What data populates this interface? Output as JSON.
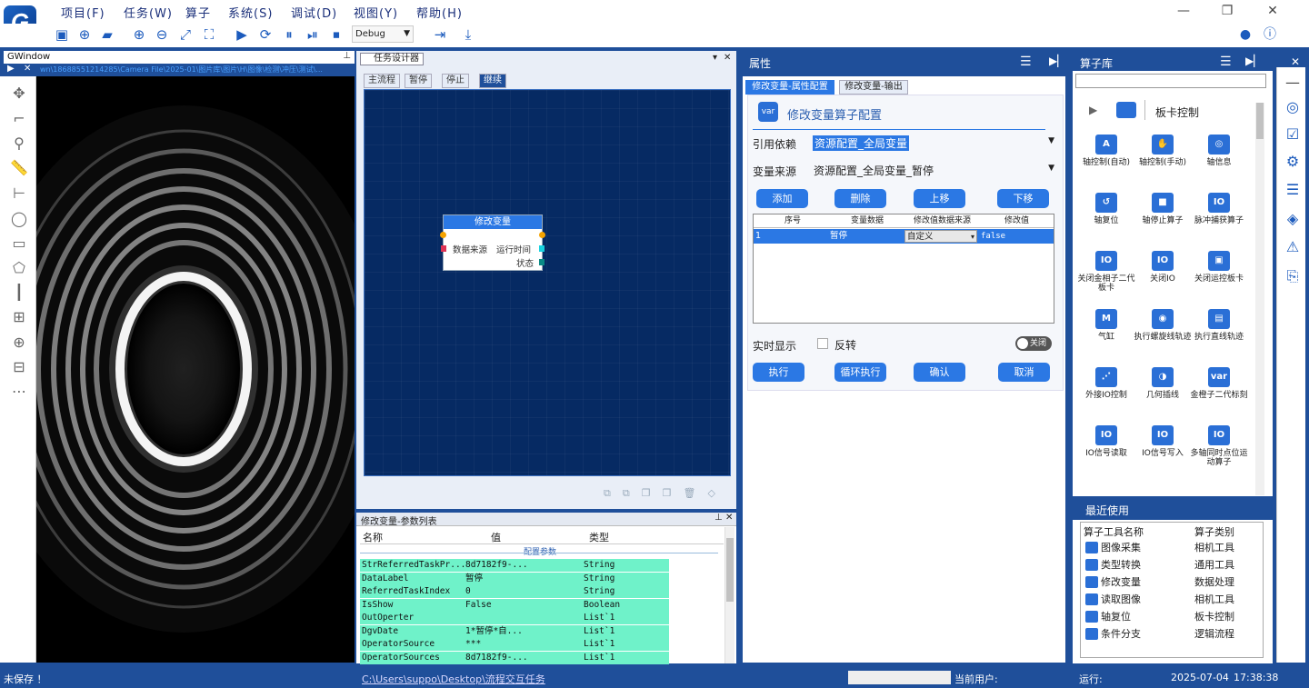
{
  "menu": [
    "项目(F)",
    "任务(W)",
    "算子",
    "系统(S)",
    "调试(D)",
    "视图(Y)",
    "帮助(H)"
  ],
  "toolbar": {
    "mode": "Debug"
  },
  "image_window": {
    "title": "GWindow",
    "path_overlay": "wn\\18688551214285\\Camera File\\2025-01\\图片库\\图片\\H\\图像\\检测\\冲压\\测试\\..."
  },
  "designer": {
    "title": "任务设计器",
    "tabs": [
      "主流程",
      "暂停",
      "停止",
      "继续"
    ],
    "node": {
      "title": "修改变量",
      "input": "数据来源",
      "output": "运行时间",
      "status": "状态"
    }
  },
  "params": {
    "title": "修改变量-参数列表",
    "headers": [
      "名称",
      "值",
      "类型"
    ],
    "group": "配置参数",
    "rows": [
      [
        "StrReferredTaskPr...",
        "8d7182f9-...",
        "String"
      ],
      [
        "DataLabel",
        "暂停",
        "String"
      ],
      [
        "ReferredTaskIndex",
        "0",
        "String"
      ],
      [
        "IsShow",
        "False",
        "Boolean"
      ],
      [
        "OutOperter",
        "",
        "List`1"
      ],
      [
        "DgvDate",
        "1*暂停*自...",
        "List`1"
      ],
      [
        "OperatorSource",
        "***",
        "List`1"
      ],
      [
        "OperatorSources",
        "8d7182f9-...",
        "List`1"
      ]
    ]
  },
  "properties": {
    "title": "属性",
    "tabs": [
      "修改变量-属性配置",
      "修改变量-输出"
    ],
    "config_title": "修改变量算子配置",
    "icon_text": "var",
    "ref_label": "引用依赖",
    "ref_value": "资源配置_全局变量",
    "src_label": "变量来源",
    "src_value": "资源配置_全局变量_暂停",
    "buttons": [
      "添加",
      "删除",
      "上移",
      "下移"
    ],
    "grid_headers": [
      "序号",
      "变量数据",
      "修改值数据来源",
      "修改值"
    ],
    "grid_row": [
      "1",
      "暂停",
      "自定义",
      "false"
    ],
    "realtime_label": "实时显示",
    "invert_label": "反转",
    "toggle_label": "关闭",
    "actions": [
      "执行",
      "循环执行",
      "确认",
      "取消"
    ]
  },
  "library": {
    "title": "算子库",
    "category": "板卡控制",
    "items": [
      {
        "label": "轴控制(自动)",
        "icon": "A"
      },
      {
        "label": "轴控制(手动)",
        "icon": "✋"
      },
      {
        "label": "轴信息",
        "icon": "◎"
      },
      {
        "label": "轴复位",
        "icon": "↺"
      },
      {
        "label": "轴停止算子",
        "icon": "■"
      },
      {
        "label": "脉冲捕获算子",
        "icon": "IO"
      },
      {
        "label": "关闭金相子二代板卡",
        "icon": "IO"
      },
      {
        "label": "关闭IO",
        "icon": "IO"
      },
      {
        "label": "关闭运控板卡",
        "icon": "▣"
      },
      {
        "label": "气缸",
        "icon": "M"
      },
      {
        "label": "执行螺旋线轨迹",
        "icon": "◉"
      },
      {
        "label": "执行直线轨迹",
        "icon": "▤"
      },
      {
        "label": "外接IO控制",
        "icon": "⋰"
      },
      {
        "label": "几何插线",
        "icon": "◑"
      },
      {
        "label": "金橙子二代标刻",
        "icon": "var"
      },
      {
        "label": "IO信号读取",
        "icon": "IO"
      },
      {
        "label": "IO信号写入",
        "icon": "IO"
      },
      {
        "label": "多轴同时点位运动算子",
        "icon": "IO"
      }
    ],
    "recent_title": "最近使用",
    "recent_headers": [
      "算子工具名称",
      "算子类别"
    ],
    "recent": [
      [
        "图像采集",
        "相机工具"
      ],
      [
        "类型转换",
        "通用工具"
      ],
      [
        "修改变量",
        "数据处理"
      ],
      [
        "读取图像",
        "相机工具"
      ],
      [
        "轴复位",
        "板卡控制"
      ],
      [
        "条件分支",
        "逻辑流程"
      ]
    ]
  },
  "status": {
    "save_state": "未保存 ！",
    "path": "C:\\Users\\suppo\\Desktop\\流程交互任务",
    "user_label": "当前用户:",
    "run_label": "运行:",
    "date": "2025-07-04",
    "time": "17:38:38"
  },
  "colors": {
    "accent": "#1f4f9a",
    "button": "#2b78e4",
    "highlight": "#6ff2c9",
    "canvas": "#062a63"
  }
}
